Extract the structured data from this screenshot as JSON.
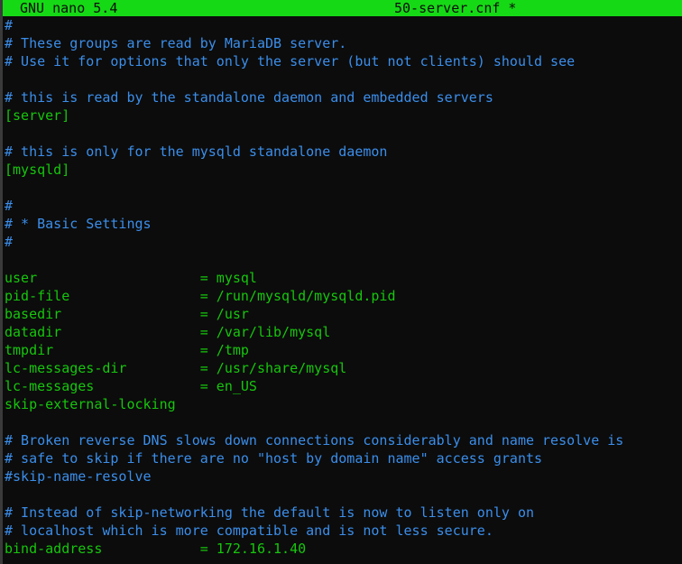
{
  "titlebar": {
    "app": "GNU nano 5.4",
    "filename": "50-server.cnf *"
  },
  "colors": {
    "titlebar_bg": "#16d916",
    "comment": "#3b8eea",
    "text": "#16c60c",
    "background": "#0c0c0c"
  },
  "lines": [
    {
      "text": "#",
      "type": "comment"
    },
    {
      "text": "# These groups are read by MariaDB server.",
      "type": "comment"
    },
    {
      "text": "# Use it for options that only the server (but not clients) should see",
      "type": "comment"
    },
    {
      "text": "",
      "type": "blank"
    },
    {
      "text": "# this is read by the standalone daemon and embedded servers",
      "type": "comment"
    },
    {
      "text": "[server]",
      "type": "section"
    },
    {
      "text": "",
      "type": "blank"
    },
    {
      "text": "# this is only for the mysqld standalone daemon",
      "type": "comment"
    },
    {
      "text": "[mysqld]",
      "type": "section"
    },
    {
      "text": "",
      "type": "blank"
    },
    {
      "text": "#",
      "type": "comment"
    },
    {
      "text": "# * Basic Settings",
      "type": "comment"
    },
    {
      "text": "#",
      "type": "comment"
    },
    {
      "text": "",
      "type": "blank"
    },
    {
      "text": "user                    = mysql",
      "type": "setting"
    },
    {
      "text": "pid-file                = /run/mysqld/mysqld.pid",
      "type": "setting"
    },
    {
      "text": "basedir                 = /usr",
      "type": "setting"
    },
    {
      "text": "datadir                 = /var/lib/mysql",
      "type": "setting"
    },
    {
      "text": "tmpdir                  = /tmp",
      "type": "setting"
    },
    {
      "text": "lc-messages-dir         = /usr/share/mysql",
      "type": "setting"
    },
    {
      "text": "lc-messages             = en_US",
      "type": "setting"
    },
    {
      "text": "skip-external-locking",
      "type": "setting"
    },
    {
      "text": "",
      "type": "blank"
    },
    {
      "text": "# Broken reverse DNS slows down connections considerably and name resolve is",
      "type": "comment"
    },
    {
      "text": "# safe to skip if there are no \"host by domain name\" access grants",
      "type": "comment"
    },
    {
      "text": "#skip-name-resolve",
      "type": "comment"
    },
    {
      "text": "",
      "type": "blank"
    },
    {
      "text": "# Instead of skip-networking the default is now to listen only on",
      "type": "comment"
    },
    {
      "text": "# localhost which is more compatible and is not less secure.",
      "type": "comment"
    },
    {
      "text": "bind-address            = 172.16.1.40",
      "type": "setting"
    }
  ]
}
